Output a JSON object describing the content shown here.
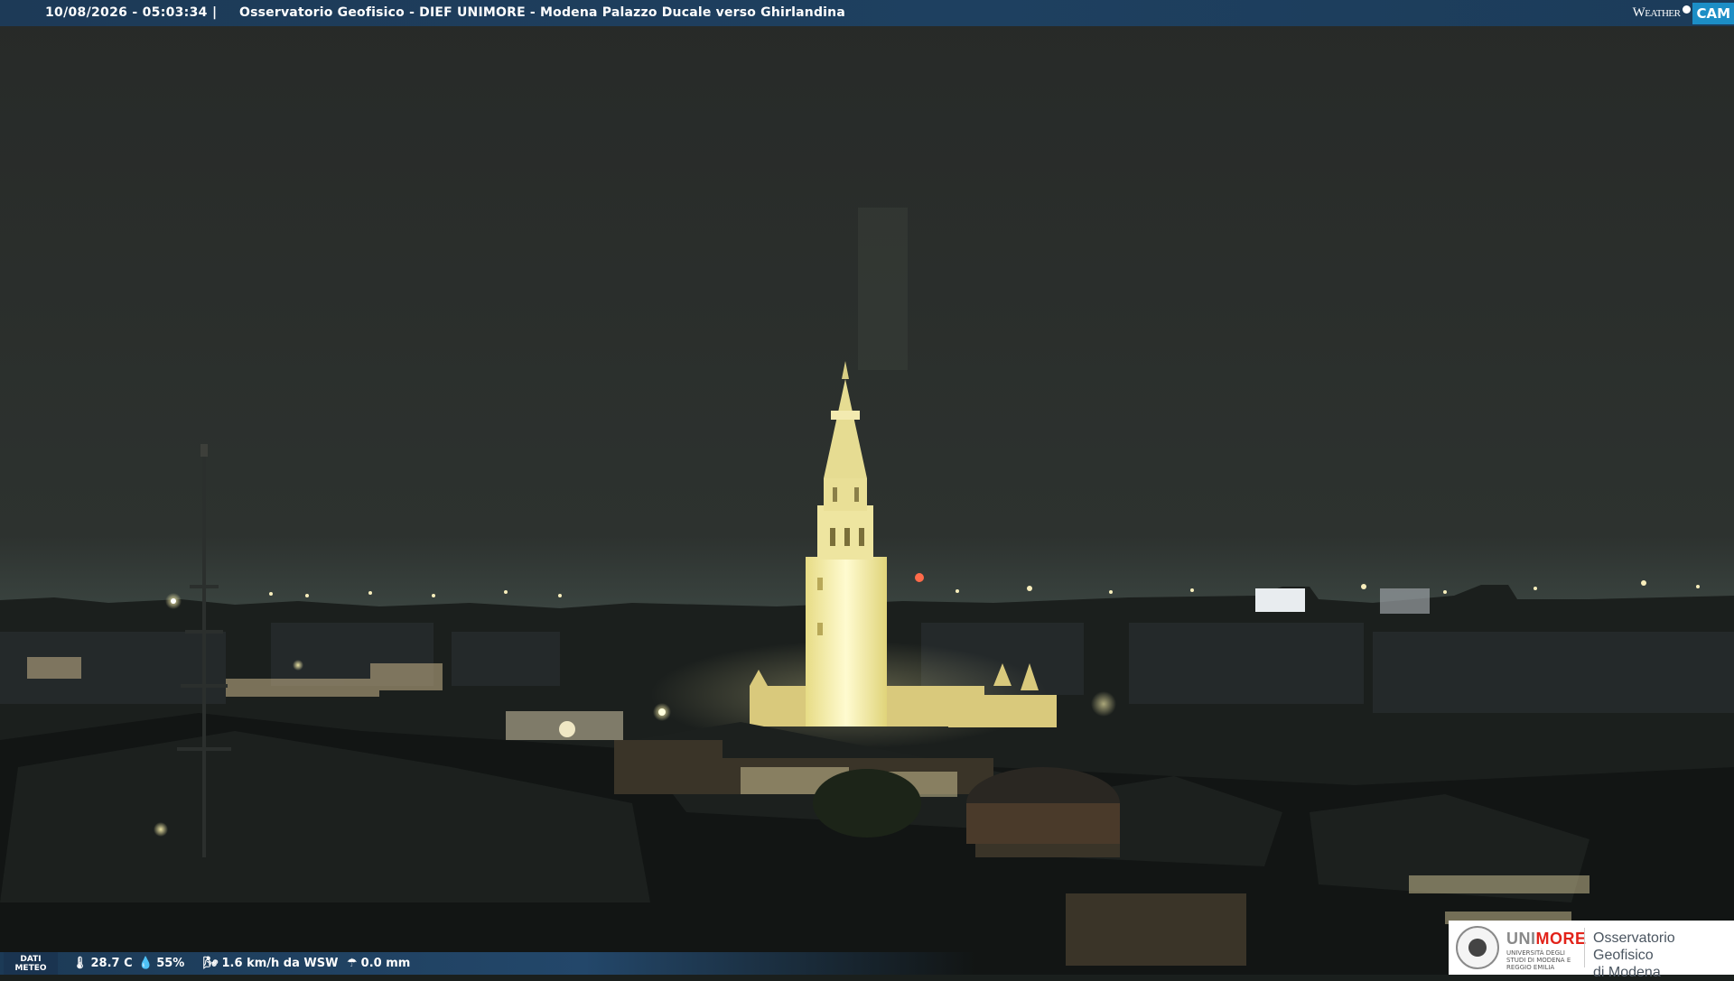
{
  "header": {
    "timestamp": "10/08/2026 - 05:03:34",
    "separator": "|",
    "title": "Osservatorio Geofisico - DIEF UNIMORE - Modena Palazzo Ducale verso Ghirlandina",
    "brand_weather": "Weather",
    "brand_cam": "CAM"
  },
  "meteo": {
    "label": "DATI METEO",
    "temperature": "28.7 C",
    "humidity": "55%",
    "wind": "1.6 km/h da WSW",
    "rain": "0.0 mm",
    "icons": [
      "thermometer-icon",
      "droplet-icon",
      "wind-icon",
      "rain-gauge-icon"
    ]
  },
  "logo": {
    "uni_prefix": "UNI",
    "uni_suffix": "MORE",
    "uni_subtitle": "UNIVERSITÀ DEGLI STUDI DI MODENA E REGGIO EMILIA",
    "observatory_line1": "Osservatorio Geofisico",
    "observatory_line2": "di Modena"
  },
  "colors": {
    "bar_blue": "#1e4060",
    "cam_blue": "#1c8ec6",
    "unimore_red": "#e2231a",
    "sky": "#2a2f2c",
    "tower_light": "#f6f0a0"
  }
}
